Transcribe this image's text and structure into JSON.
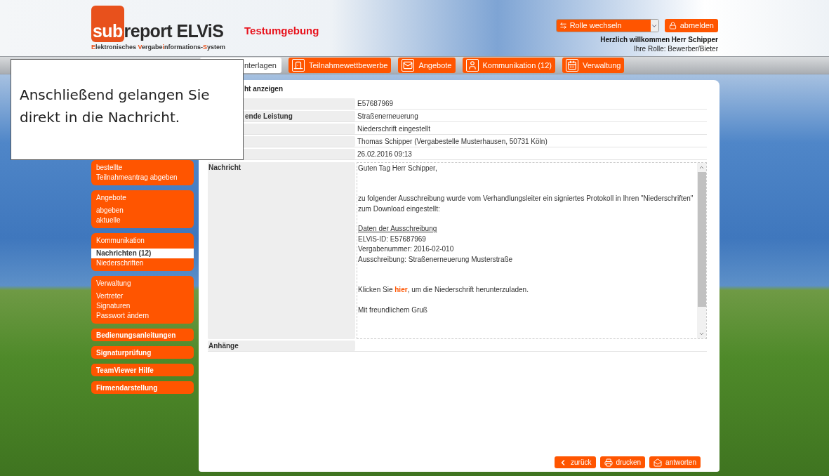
{
  "header": {
    "logo": [
      {
        "text": "sub",
        "accent": true
      },
      {
        "text": "report ELViS",
        "accent": false
      }
    ],
    "subtitle": [
      {
        "text": "E",
        "accent": true
      },
      {
        "text": "lektronisches ",
        "accent": false
      },
      {
        "text": "V",
        "accent": true
      },
      {
        "text": "ergabe",
        "accent": false
      },
      {
        "text": "i",
        "accent": true
      },
      {
        "text": "nformations-",
        "accent": false
      },
      {
        "text": "S",
        "accent": true
      },
      {
        "text": "ystem",
        "accent": false
      }
    ],
    "environment": "Testumgebung",
    "role_select": "Rolle wechseln",
    "logout": "abmelden",
    "welcome": "Herzlich willkommen Herr Schipper",
    "role": "Ihre Rolle: Bewerber/Bieter"
  },
  "tabs": [
    {
      "label": "nterlagen",
      "selected": true
    },
    {
      "label": "Teilnahmewettbewerbe",
      "selected": false
    },
    {
      "label": "Angebote",
      "selected": false
    },
    {
      "label": "Kommunikation (12)",
      "selected": false
    },
    {
      "label": "Verwaltung",
      "selected": false
    }
  ],
  "sidebar": [
    {
      "kind": "group",
      "items": [
        {
          "label": "bestellte",
          "selected": false
        },
        {
          "label": "Teilnahmeantrag abgeben",
          "selected": false
        }
      ]
    },
    {
      "kind": "group",
      "title": "Angebote",
      "items": [
        {
          "label": "abgeben",
          "selected": false
        },
        {
          "label": "aktuelle",
          "selected": false
        }
      ]
    },
    {
      "kind": "group",
      "title": "Kommunikation",
      "items": [
        {
          "label": "Nachrichten (12)",
          "selected": true
        },
        {
          "label": "Niederschriften",
          "selected": false
        }
      ]
    },
    {
      "kind": "group",
      "title": "Verwaltung",
      "items": [
        {
          "label": "Vertreter",
          "selected": false
        },
        {
          "label": "Signaturen",
          "selected": false
        },
        {
          "label": "Passwort ändern",
          "selected": false
        }
      ]
    },
    {
      "kind": "link",
      "title": "Bedienungsanleitungen"
    },
    {
      "kind": "link",
      "title": "Signaturprüfung"
    },
    {
      "kind": "link",
      "title": "TeamViewer Hilfe"
    },
    {
      "kind": "link",
      "title": "Firmendarstellung"
    }
  ],
  "panel": {
    "title": "ht anzeigen",
    "rows": [
      {
        "kind": "meta",
        "value": "E57687969"
      },
      {
        "kind": "meta",
        "label": "ende Leistung",
        "value": "Straßenerneuerung"
      },
      {
        "kind": "meta",
        "value": "Niederschrift eingestellt"
      },
      {
        "kind": "meta",
        "value": "Thomas Schipper (Vergabestelle Musterhausen, 50731 Köln)"
      },
      {
        "kind": "meta",
        "value": "26.02.2016 09:13"
      },
      {
        "kind": "message",
        "label": "Nachricht"
      },
      {
        "kind": "attachments",
        "label": "Anhänge"
      }
    ],
    "message": [
      {
        "kind": "text",
        "text": "Guten Tag Herr Schipper,"
      },
      {
        "kind": "spacer"
      },
      {
        "kind": "spacer"
      },
      {
        "kind": "text",
        "text": "zu folgender Ausschreibung wurde vom Verhandlungsleiter ein signiertes Protokoll in Ihren \"Niederschriften\""
      },
      {
        "kind": "text",
        "text": "zum Download eingestellt:"
      },
      {
        "kind": "spacer"
      },
      {
        "kind": "heading",
        "text": "Daten der Ausschreibung"
      },
      {
        "kind": "text",
        "text": "ELViS-ID: E57687969"
      },
      {
        "kind": "text",
        "text": "Vergabenummer: 2016-02-010"
      },
      {
        "kind": "text",
        "text": "Ausschreibung: Straßenerneuerung Musterstraße"
      },
      {
        "kind": "spacer"
      },
      {
        "kind": "spacer"
      },
      {
        "kind": "link",
        "before": "Klicken Sie ",
        "link": "hier",
        "after": ", um die Niederschrift herunterzuladen."
      },
      {
        "kind": "spacer"
      },
      {
        "kind": "text",
        "text": "Mit freundlichem Gruß"
      }
    ],
    "buttons": [
      {
        "label": "zurück"
      },
      {
        "label": "drucken"
      },
      {
        "label": "antworten"
      }
    ]
  },
  "callout": "Anschließend gelangen Sie direkt in die Nachricht."
}
